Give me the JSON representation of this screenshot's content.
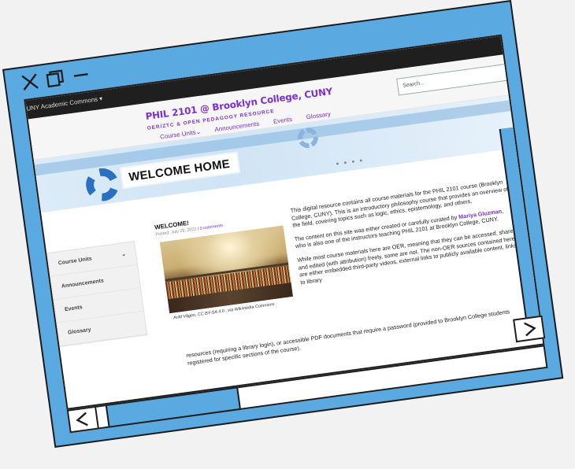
{
  "window": {
    "controls": [
      "close-icon",
      "restore-icon",
      "minimize-icon"
    ]
  },
  "admin_bar": {
    "label": "CUNY Academic Commons  ▾"
  },
  "search": {
    "placeholder": "Search..."
  },
  "site": {
    "title": "PHIL 2101 @ Brooklyn College, CUNY",
    "tagline": "OER/ZTC & OPEN PEDAGOGY RESOURCE"
  },
  "nav": {
    "items": [
      "Course Units⌄",
      "Announcements",
      "Events",
      "Glossary"
    ]
  },
  "hero": {
    "heading": "WELCOME HOME",
    "dots": "● ● ● ●"
  },
  "sidebar": {
    "items": [
      "Course Units",
      "Announcements",
      "Events",
      "Glossary"
    ],
    "chevron": "⌄"
  },
  "post": {
    "title": "WELCOME!",
    "meta_date": "Posted: July 29, 2022 |",
    "meta_comments": "0 comments",
    "caption": "Arild Vågen, CC BY-SA 4.0 , via Wikimedia Commons",
    "p1": "This digital resource contains all course materials for the PHIL 2101 course (Brooklyn College, CUNY). This is an introductory philosophy course that provides an overview of the field, covering topics such as logic, ethics, epistemology, and others.",
    "p2_before": "The content on this site was either created or carefully curated by",
    "p2_author": "Mariya Gluzman",
    "p2_after": ", who is also one of the instructors teaching PHIL 2101 at Brooklyn College, CUNY.",
    "p3": "While most course materials here are OER, meaning that they can be accessed, shared, and edited (with attribution) freely, some are not. The non-OER sources contained here are either embedded third-party videos, external links to publicly available content, links to library",
    "p3_cont": "resources (requiring a library login), or accessible PDF documents that require a password (provided to Brooklyn College students registered for specific sections of the course)."
  },
  "scroll": {
    "left_arrow": "<",
    "right_arrow": ">"
  }
}
